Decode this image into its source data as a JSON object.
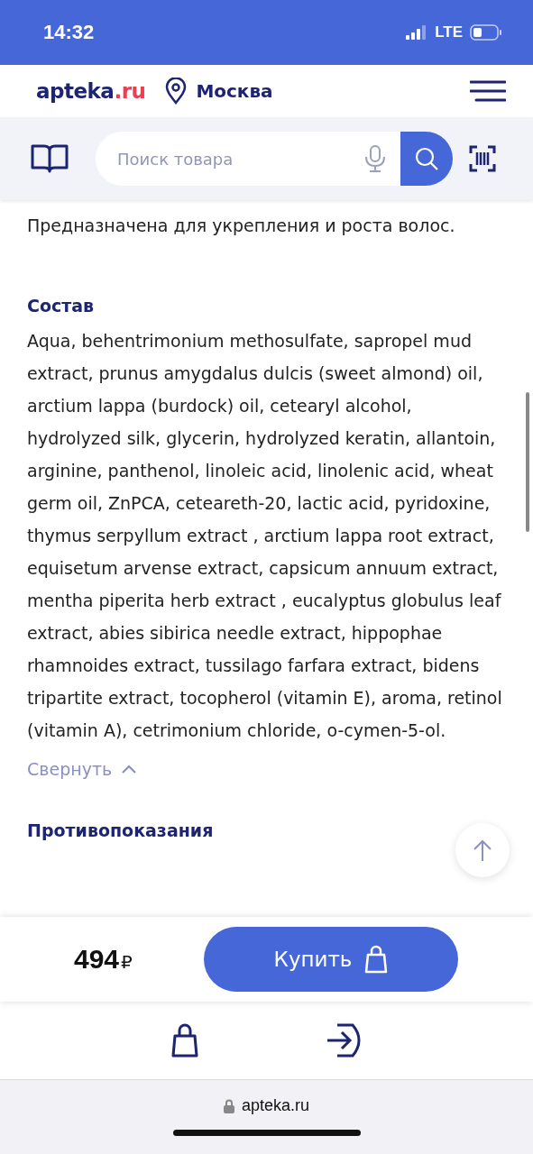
{
  "status_bar": {
    "time": "14:32",
    "network": "LTE"
  },
  "header": {
    "logo_main": "apteka",
    "logo_accent": ".ru",
    "city": "Москва"
  },
  "search": {
    "placeholder": "Поиск товара"
  },
  "content": {
    "intro": "Предназначена для укрепления и роста волос.",
    "sections": [
      {
        "title": "Состав",
        "text": "Aqua, behentrimonium methosulfate, sapropel mud extract, prunus amygdalus dulcis (sweet almond) oil, arctium lappa (burdock) oil, cetearyl alcohol, hydrolyzed silk, glycerin, hydrolyzed keratin, allantoin, arginine, panthenol, linoleic acid, linolenic acid, wheat germ oil, ZnPCA, ceteareth-20, lactic acid, pyridoxine, thymus serpyllum extract , arctium lappa root extract, equisetum arvense extract, capsicum annuum extract, mentha piperita herb extract , eucalyptus globulus leaf extract, abies sibirica needle extract, hippophae rhamnoides extract, tussilago farfara extract, bidens tripartite extract, tocopherol (vitamin E), aroma, retinol (vitamin A), cetrimonium chloride, o-cymen-5-ol.",
        "toggle": "Свернуть",
        "expanded": true
      },
      {
        "title": "Противопоказания"
      }
    ]
  },
  "buy_bar": {
    "price": "494",
    "currency": "₽",
    "button": "Купить"
  },
  "browser": {
    "url": "apteka.ru"
  }
}
